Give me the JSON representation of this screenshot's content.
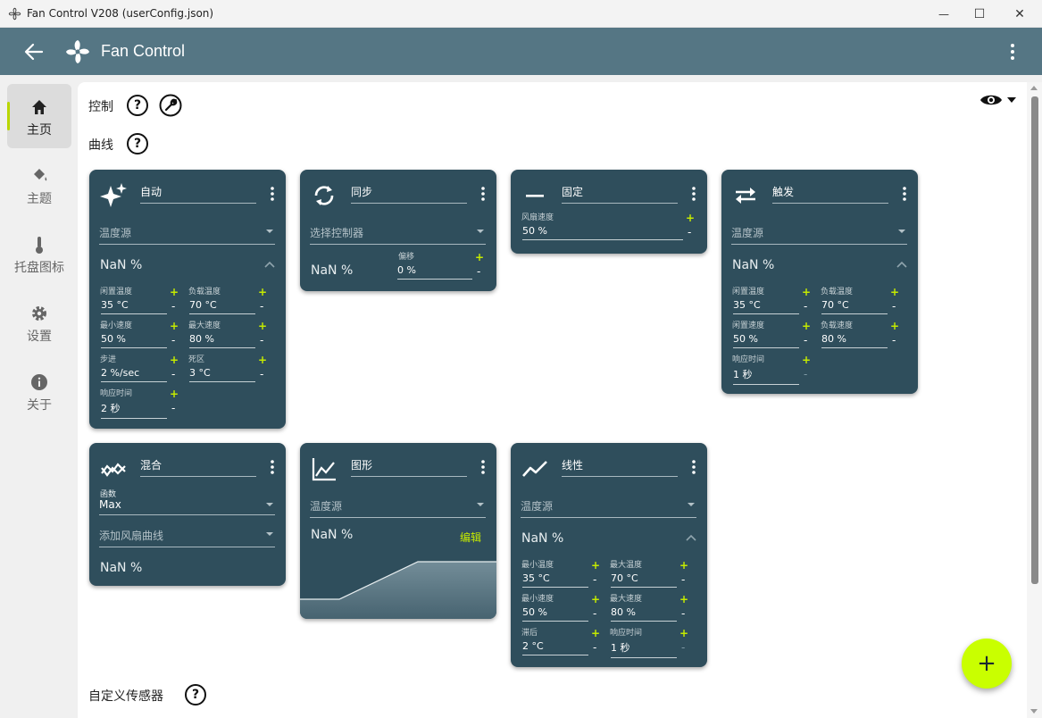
{
  "window": {
    "title": "Fan Control V208 (userConfig.json)",
    "minimize_glyph": "—",
    "maximize_glyph": "☐",
    "close_glyph": "✕"
  },
  "appbar": {
    "title": "Fan Control"
  },
  "nav": {
    "items": [
      {
        "label": "主页",
        "icon": "home-icon",
        "active": true
      },
      {
        "label": "主题",
        "icon": "paint-bucket-icon"
      },
      {
        "label": "托盘图标",
        "icon": "thermometer-icon"
      },
      {
        "label": "设置",
        "icon": "gear-icon"
      },
      {
        "label": "关于",
        "icon": "info-icon"
      }
    ]
  },
  "sections": {
    "controls": "控制",
    "curves": "曲线",
    "custom_sensors": "自定义传感器",
    "help_glyph": "?"
  },
  "colors": {
    "card_bg": "#2f4e5c",
    "accent": "#c5ea00",
    "appbar": "#557684",
    "fab": "#c9ff00"
  },
  "cards": {
    "auto": {
      "title": "自动",
      "source": "温度源",
      "value": "NaN %",
      "fields": [
        {
          "label": "闲置温度",
          "value": "35 °C"
        },
        {
          "label": "负载温度",
          "value": "70 °C"
        },
        {
          "label": "最小速度",
          "value": "50 %"
        },
        {
          "label": "最大速度",
          "value": "80 %"
        },
        {
          "label": "步进",
          "value": "2 %/sec"
        },
        {
          "label": "死区",
          "value": "3 °C"
        },
        {
          "label": "响应时间",
          "value": "2 秒"
        }
      ]
    },
    "sync": {
      "title": "同步",
      "source": "选择控制器",
      "value": "NaN %",
      "offset_label": "偏移",
      "offset_value": "0 %"
    },
    "fixed": {
      "title": "固定",
      "speed_label": "风扇速度",
      "speed_value": "50 %"
    },
    "trigger": {
      "title": "触发",
      "source": "温度源",
      "value": "NaN %",
      "fields": [
        {
          "label": "闲置温度",
          "value": "35 °C"
        },
        {
          "label": "负载温度",
          "value": "70 °C"
        },
        {
          "label": "闲置速度",
          "value": "50 %"
        },
        {
          "label": "负载速度",
          "value": "80 %"
        },
        {
          "label": "响应时间",
          "value": "1 秒"
        }
      ]
    },
    "mix": {
      "title": "混合",
      "function_label": "函数",
      "function_value": "Max",
      "add_curve": "添加风扇曲线",
      "value": "NaN %"
    },
    "graph": {
      "title": "图形",
      "source": "温度源",
      "value": "NaN %",
      "edit": "编辑"
    },
    "linear": {
      "title": "线性",
      "source": "温度源",
      "value": "NaN %",
      "fields": [
        {
          "label": "最小温度",
          "value": "35 °C"
        },
        {
          "label": "最大温度",
          "value": "70 °C"
        },
        {
          "label": "最小速度",
          "value": "50 %"
        },
        {
          "label": "最大速度",
          "value": "80 %"
        },
        {
          "label": "滞后",
          "value": "2 °C"
        },
        {
          "label": "响应时间",
          "value": "1 秒"
        }
      ]
    }
  },
  "glyphs": {
    "plus": "+",
    "minus": "-",
    "fab": "+"
  }
}
